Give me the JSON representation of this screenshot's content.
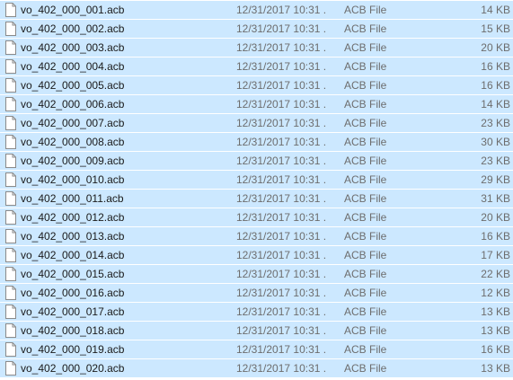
{
  "file_list": {
    "rows": [
      {
        "name": "vo_402_000_001.acb",
        "date": "12/31/2017 10:31 ...",
        "type": "ACB File",
        "size": "14 KB",
        "icon": "document-icon"
      },
      {
        "name": "vo_402_000_002.acb",
        "date": "12/31/2017 10:31 ...",
        "type": "ACB File",
        "size": "15 KB",
        "icon": "document-icon"
      },
      {
        "name": "vo_402_000_003.acb",
        "date": "12/31/2017 10:31 ...",
        "type": "ACB File",
        "size": "20 KB",
        "icon": "document-icon"
      },
      {
        "name": "vo_402_000_004.acb",
        "date": "12/31/2017 10:31 ...",
        "type": "ACB File",
        "size": "16 KB",
        "icon": "document-icon"
      },
      {
        "name": "vo_402_000_005.acb",
        "date": "12/31/2017 10:31 ...",
        "type": "ACB File",
        "size": "16 KB",
        "icon": "document-icon"
      },
      {
        "name": "vo_402_000_006.acb",
        "date": "12/31/2017 10:31 ...",
        "type": "ACB File",
        "size": "14 KB",
        "icon": "document-icon"
      },
      {
        "name": "vo_402_000_007.acb",
        "date": "12/31/2017 10:31 ...",
        "type": "ACB File",
        "size": "23 KB",
        "icon": "document-icon"
      },
      {
        "name": "vo_402_000_008.acb",
        "date": "12/31/2017 10:31 ...",
        "type": "ACB File",
        "size": "30 KB",
        "icon": "document-icon"
      },
      {
        "name": "vo_402_000_009.acb",
        "date": "12/31/2017 10:31 ...",
        "type": "ACB File",
        "size": "23 KB",
        "icon": "document-icon"
      },
      {
        "name": "vo_402_000_010.acb",
        "date": "12/31/2017 10:31 ...",
        "type": "ACB File",
        "size": "29 KB",
        "icon": "document-icon"
      },
      {
        "name": "vo_402_000_011.acb",
        "date": "12/31/2017 10:31 ...",
        "type": "ACB File",
        "size": "31 KB",
        "icon": "document-icon"
      },
      {
        "name": "vo_402_000_012.acb",
        "date": "12/31/2017 10:31 ...",
        "type": "ACB File",
        "size": "20 KB",
        "icon": "document-icon"
      },
      {
        "name": "vo_402_000_013.acb",
        "date": "12/31/2017 10:31 ...",
        "type": "ACB File",
        "size": "16 KB",
        "icon": "document-icon"
      },
      {
        "name": "vo_402_000_014.acb",
        "date": "12/31/2017 10:31 ...",
        "type": "ACB File",
        "size": "17 KB",
        "icon": "document-icon"
      },
      {
        "name": "vo_402_000_015.acb",
        "date": "12/31/2017 10:31 ...",
        "type": "ACB File",
        "size": "22 KB",
        "icon": "document-icon"
      },
      {
        "name": "vo_402_000_016.acb",
        "date": "12/31/2017 10:31 ...",
        "type": "ACB File",
        "size": "12 KB",
        "icon": "document-icon"
      },
      {
        "name": "vo_402_000_017.acb",
        "date": "12/31/2017 10:31 ...",
        "type": "ACB File",
        "size": "13 KB",
        "icon": "document-icon"
      },
      {
        "name": "vo_402_000_018.acb",
        "date": "12/31/2017 10:31 ...",
        "type": "ACB File",
        "size": "13 KB",
        "icon": "document-icon"
      },
      {
        "name": "vo_402_000_019.acb",
        "date": "12/31/2017 10:31 ...",
        "type": "ACB File",
        "size": "16 KB",
        "icon": "document-icon"
      },
      {
        "name": "vo_402_000_020.acb",
        "date": "12/31/2017 10:31 ...",
        "type": "ACB File",
        "size": "13 KB",
        "icon": "document-icon"
      }
    ],
    "selected": true,
    "selection_color": "#cce8ff"
  }
}
